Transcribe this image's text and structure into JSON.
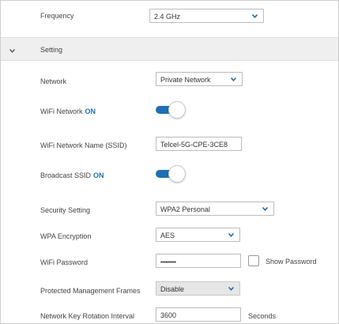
{
  "colors": {
    "accent": "#1f6fb2",
    "section_bg": "#efefef"
  },
  "frequency": {
    "label": "Frequency",
    "value": "2.4 GHz"
  },
  "section": {
    "label": "Setting",
    "chevron_icon": "chevron-down-icon"
  },
  "network": {
    "label": "Network",
    "value": "Private Network"
  },
  "wifi_network": {
    "label": "WiFi Network",
    "status": "ON",
    "enabled": true
  },
  "ssid": {
    "label": "WiFi Network Name (SSID)",
    "value": "Telcel-5G-CPE-3CE8"
  },
  "broadcast_ssid": {
    "label": "Broadcast SSID",
    "status": "ON",
    "enabled": true
  },
  "security_setting": {
    "label": "Security Setting",
    "value": "WPA2 Personal"
  },
  "wpa_encryption": {
    "label": "WPA Encryption",
    "value": "AES"
  },
  "wifi_password": {
    "label": "WiFi Password",
    "value": "••••••••••",
    "show_label": "Show Password",
    "show_checked": false
  },
  "pmf": {
    "label": "Protected Management Frames",
    "value": "Disable"
  },
  "key_rotation": {
    "label": "Network Key Rotation Interval",
    "value": "3600",
    "unit": "Seconds"
  }
}
